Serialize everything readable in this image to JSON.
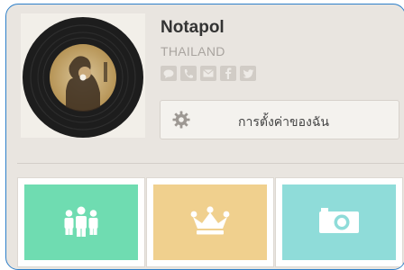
{
  "profile": {
    "name": "Notapol",
    "country": "THAILAND",
    "social_icons": [
      "chat-icon",
      "phone-icon",
      "mail-icon",
      "facebook-icon",
      "twitter-icon"
    ]
  },
  "settings": {
    "label": "การตั้งค่าของฉัน",
    "icon": "gear-icon"
  },
  "tiles": [
    {
      "icon": "friends-icon",
      "color": "#6fdcb1"
    },
    {
      "icon": "crown-icon",
      "color": "#f0d08e"
    },
    {
      "icon": "camera-icon",
      "color": "#8fdcd9"
    }
  ],
  "colors": {
    "accent_border": "#2d7fc9",
    "background": "#e9e5e0"
  }
}
